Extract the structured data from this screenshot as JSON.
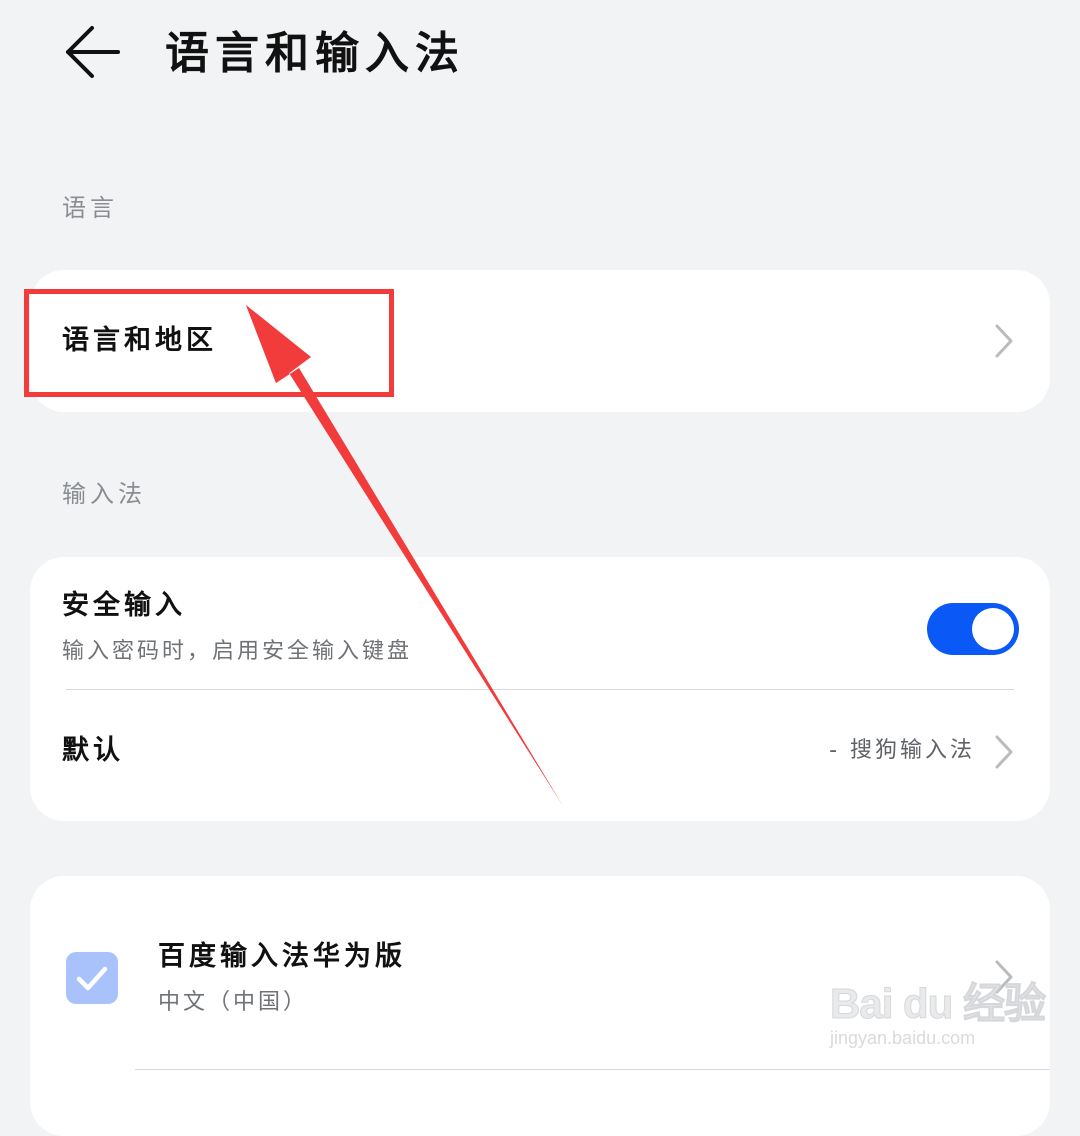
{
  "header": {
    "title": "语言和输入法"
  },
  "language_section": {
    "label": "语言",
    "items": [
      {
        "title": "语言和地区"
      }
    ]
  },
  "input_section": {
    "label": "输入法",
    "secure_input": {
      "title": "安全输入",
      "subtitle": "输入密码时，启用安全输入键盘",
      "enabled": true
    },
    "default": {
      "title": "默认",
      "value": "- 搜狗输入法"
    }
  },
  "ime_list": [
    {
      "title": "百度输入法华为版",
      "subtitle": "中文（中国）",
      "checked": true
    }
  ],
  "watermark": {
    "logo_text": "Bai du 经验",
    "url": "jingyan.baidu.com"
  },
  "colors": {
    "background": "#f1f3f5",
    "card": "#ffffff",
    "toggle_on": "#0a59f7",
    "checkbox": "#a9c2fb",
    "annotation": "#f23b3b"
  },
  "icons": {
    "back": "back-arrow-icon",
    "chevron": "chevron-right-icon",
    "check": "checkmark-icon"
  }
}
